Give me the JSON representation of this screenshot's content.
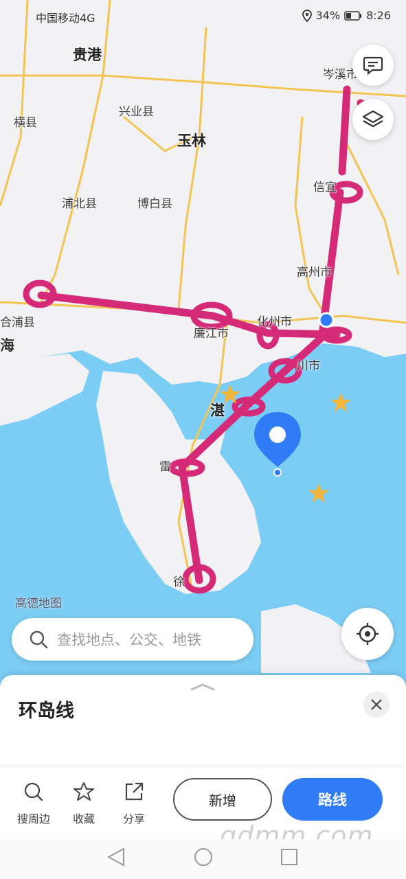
{
  "status_bar": {
    "carrier": "中国移动4G",
    "battery": "34%",
    "time": "8:26"
  },
  "map": {
    "labels": {
      "guigang": "贵港",
      "cenxi": "岑溪市",
      "hengxian": "横县",
      "xingye": "兴业县",
      "yulin": "玉林",
      "xinyi": "信宜",
      "pubei": "浦北县",
      "bobai": "博白县",
      "gaozhou": "高州市",
      "hepu": "合浦县",
      "beihai": "海",
      "huazhou": "化州市",
      "lianjiang": "廉江市",
      "wuchuan": "川市",
      "zhanjiang": "湛",
      "leizhou": "雷",
      "xuwen": "徐"
    },
    "watermark": "高德地图",
    "colors": {
      "land": "#f2f2f5",
      "sea": "#7ccdf5",
      "route_mark": "#d42a78",
      "pin": "#2f7cf6",
      "highway": "#f4c453"
    }
  },
  "buttons": {
    "message_icon": "message-icon",
    "layers_icon": "layers-icon",
    "locate_icon": "locate-icon"
  },
  "search": {
    "placeholder": "查找地点、公交、地铁"
  },
  "sheet": {
    "title": "环岛线",
    "actions": [
      {
        "label": "搜周边",
        "icon": "search-icon"
      },
      {
        "label": "收藏",
        "icon": "star-icon"
      },
      {
        "label": "分享",
        "icon": "share-icon"
      }
    ],
    "add_label": "新增",
    "route_label": "路线"
  },
  "site_watermark": "gdmm.com"
}
